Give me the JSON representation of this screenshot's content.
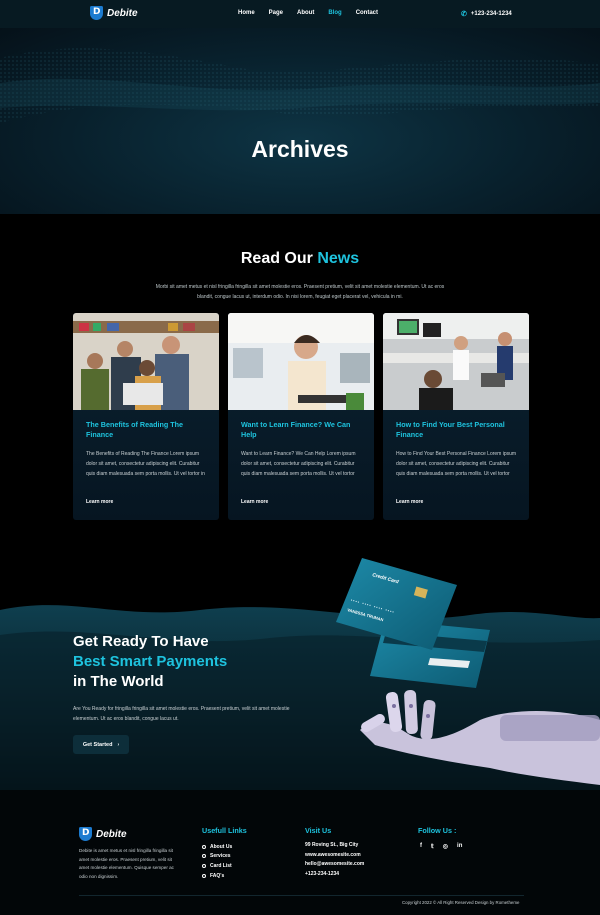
{
  "nav": {
    "logo_text": "Debite",
    "items": [
      {
        "label": "Home"
      },
      {
        "label": "Page"
      },
      {
        "label": "About"
      },
      {
        "label": "Blog"
      },
      {
        "label": "Contact"
      }
    ],
    "active_item": "Blog",
    "phone": "+123-234-1234"
  },
  "hero": {
    "title": "Archives"
  },
  "news": {
    "title_plain": "Read Our",
    "title_accent": "News",
    "intro": "Morbi sit amet metus et nisl fringilla fringilla sit amet molestie eros. Praesent pretium, velit sit amet molestie elementum. Ut ac eros blandit, congue lacus ut, interdum odio. In nisi lorem, feugiat eget placerat vel, vehicula in mi.",
    "cards": [
      {
        "title": "The Benefits of Reading The Finance",
        "body": "The Benefits of Reading The Finance Lorem ipsum dolor sit amet, consectetur adipiscing elit. Curabitur quis diam malesuada sem porta mollis. Ut vel tortor in",
        "link": "Learn more"
      },
      {
        "title": "Want to Learn Finance? We Can Help",
        "body": "Want to Learn Finance? We Can Help Lorem ipsum dolor sit amet, consectetur adipiscing elit. Curabitur quis diam malesuada sem porta mollis. Ut vel tortor",
        "link": "Learn more"
      },
      {
        "title": "How to Find Your Best Personal Finance",
        "body": "How to Find Your Best Personal Finance Lorem ipsum dolor sit amet, consectetur adipiscing elit. Curabitur quis diam malesuada sem porta mollis. Ut vel tortor",
        "link": "Learn more"
      }
    ]
  },
  "promo": {
    "line1": "Get Ready To Have",
    "line2": "Best Smart Payments",
    "line3": "in The World",
    "body": "Are You Ready for fringilla fringilla sit amet molestie eros. Praesent pretium, velit sit amet molestie elementum.  Ut ac eros blandit, congue lacus ut.",
    "button": "Get Started",
    "card_label": "Credit Card",
    "card_name": "VANESSA TRUMAN"
  },
  "footer": {
    "logo_text": "Debite",
    "about": "Debite is amet metus et nisl fringilla fringilla sit amet molestie eros. Praesent pretium, velit sit amet molestie elementum. Quisque semper ac odio non dignissim.",
    "links_title": "Usefull Links",
    "links": [
      "About Us",
      "Services",
      "Card List",
      "FAQ's"
    ],
    "visit_title": "Visit Us",
    "address": "99 Roving St., Big City",
    "website": "www.awesomesite.com",
    "email": "hello@awesomesite.com",
    "phone": "+123-234-1234",
    "follow_title": "Follow Us :",
    "social": [
      "facebook-icon",
      "twitter-icon",
      "instagram-icon",
      "linkedin-icon"
    ],
    "copyright": "Copyright 2022 © All Right Reserved Design by Rometheme"
  },
  "colors": {
    "accent": "#1ec3de",
    "background": "#000000",
    "nav_bg": "#071a22",
    "card_bg": "#0b2231"
  }
}
